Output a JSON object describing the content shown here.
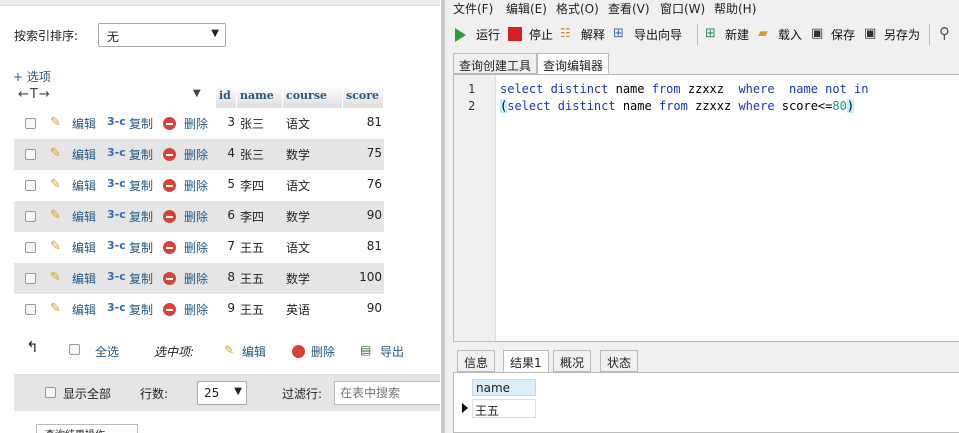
{
  "left": {
    "sort_label": "按索引排序:",
    "sort_value": "无",
    "options_link": "+ 选项",
    "col_arrows": "←T→",
    "headers": {
      "id": "id",
      "name": "name",
      "course": "course",
      "score": "score"
    },
    "actions": {
      "edit": "编辑",
      "copy": "复制",
      "delete": "删除"
    },
    "rows": [
      {
        "id": "3",
        "name": "张三",
        "course": "语文",
        "score": "81"
      },
      {
        "id": "4",
        "name": "张三",
        "course": "数学",
        "score": "75"
      },
      {
        "id": "5",
        "name": "李四",
        "course": "语文",
        "score": "76"
      },
      {
        "id": "6",
        "name": "李四",
        "course": "数学",
        "score": "90"
      },
      {
        "id": "7",
        "name": "王五",
        "course": "语文",
        "score": "81"
      },
      {
        "id": "8",
        "name": "王五",
        "course": "数学",
        "score": "100"
      },
      {
        "id": "9",
        "name": "王五",
        "course": "英语",
        "score": "90"
      }
    ],
    "bulk": {
      "select_all": "全选",
      "selected": "选中项:",
      "edit": "编辑",
      "delete": "删除",
      "export": "导出"
    },
    "footer": {
      "show_all": "显示全部",
      "rows_label": "行数:",
      "rows_value": "25",
      "filter_label": "过滤行:",
      "filter_placeholder": "在表中搜索"
    },
    "bottom_tab": "查询结果操作"
  },
  "right": {
    "menu": [
      "文件(F)",
      "编辑(E)",
      "格式(O)",
      "查看(V)",
      "窗口(W)",
      "帮助(H)"
    ],
    "toolbar": {
      "run": "运行",
      "stop": "停止",
      "explain": "解释",
      "export_wizard": "导出向导",
      "new": "新建",
      "load": "载入",
      "save": "保存",
      "save_as": "另存为"
    },
    "tabs": [
      "查询创建工具",
      "查询编辑器"
    ],
    "editor": {
      "line_numbers": [
        "1",
        "2"
      ],
      "line1": {
        "kw1": "select distinct",
        "t1": " name ",
        "kw2": "from",
        "t2": " zzxxz  ",
        "kw3": "where",
        "t3": "  ",
        "kw4": "name not in"
      },
      "line2": {
        "p1": "(",
        "kw1": "select distinct",
        "t1": " name ",
        "kw2": "from",
        "t2": " zzxxz ",
        "kw3": "where",
        "t3": " score<=",
        "num": "80",
        "p2": ")"
      }
    },
    "result_tabs": [
      "信息",
      "结果1",
      "概况",
      "状态"
    ],
    "result": {
      "column": "name",
      "value": "王五"
    }
  },
  "colors": {
    "link": "#235a81",
    "keyword": "#1a34c8",
    "number": "#1aa080",
    "row_alt": "#e5e5e5",
    "delete_icon": "#d9413b"
  }
}
